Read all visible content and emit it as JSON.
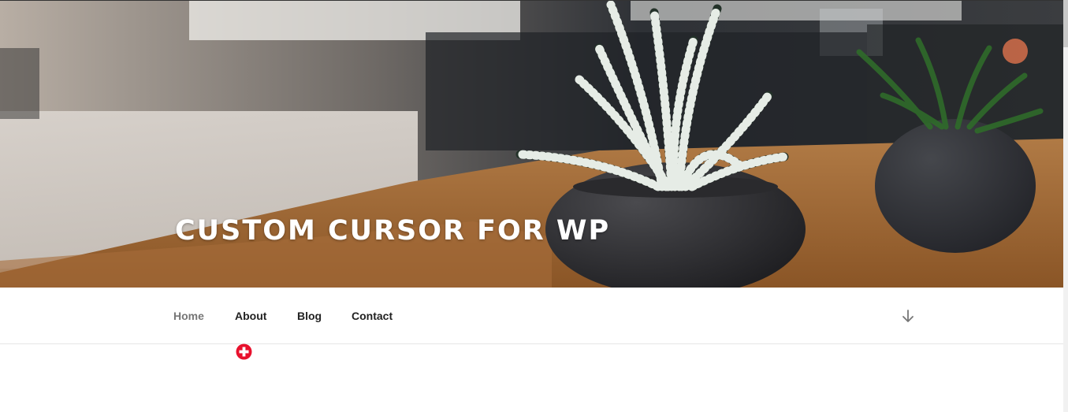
{
  "site": {
    "title": "CUSTOM CURSOR FOR WP"
  },
  "nav": {
    "items": [
      {
        "label": "Home",
        "current": true
      },
      {
        "label": "About",
        "current": false
      },
      {
        "label": "Blog",
        "current": false
      },
      {
        "label": "Contact",
        "current": false
      }
    ],
    "scroll_icon": "arrow-down-icon"
  },
  "cursor": {
    "icon": "plus-circle-cursor-icon",
    "color": "#e8112d"
  },
  "colors": {
    "nav_text": "#222222",
    "nav_current": "#767676",
    "title": "#ffffff"
  }
}
